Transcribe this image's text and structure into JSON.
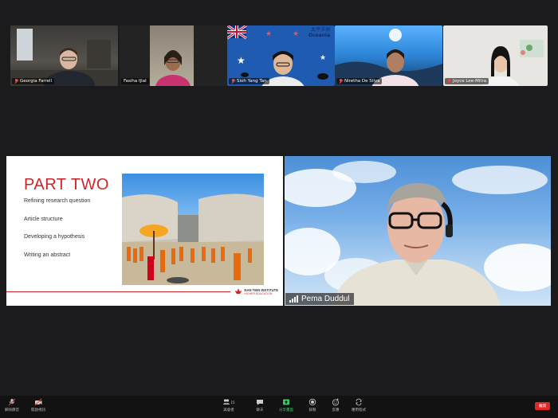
{
  "participants": [
    {
      "name": "Georgia Farrell",
      "muted": true
    },
    {
      "name": "Fasiha Ijlal",
      "muted": false
    },
    {
      "name": "Sioh Yang Tan",
      "muted": true
    },
    {
      "name": "Niretha De Silva",
      "muted": true
    },
    {
      "name": "Joyce Lee-Mitra",
      "muted": true
    }
  ],
  "thumbnail_text": {
    "oceania_cn": "太平洋洲",
    "oceania": "Oceania"
  },
  "slide": {
    "title": "PART TWO",
    "bullets": [
      "Refining research question",
      "Article structure",
      "Developing a hypothesis",
      "Writing an abstract"
    ],
    "logo_name": "NAN TIEN INSTITUTE",
    "logo_sub": "HIGHER EDUCATION"
  },
  "speaker": {
    "name": "Pema Duddul"
  },
  "toolbar": {
    "mute": "解除靜音",
    "video": "開啟視訊",
    "participants": "與會者",
    "participants_count": "15",
    "chat": "聊天",
    "share": "分享畫面",
    "record": "錄製",
    "reactions": "反應",
    "apps": "應用程式",
    "end": "離開"
  },
  "colors": {
    "accent_red": "#d2232a",
    "share_green": "#37c76a",
    "end_red": "#e02828"
  }
}
